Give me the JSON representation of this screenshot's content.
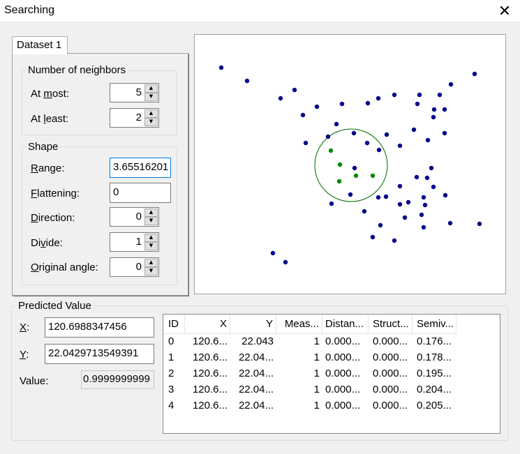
{
  "window": {
    "title": "Searching"
  },
  "tab": {
    "label": "Dataset 1"
  },
  "neighbors": {
    "group_title": "Number of neighbors",
    "at_most_label": "At most:",
    "at_most_value": "5",
    "at_least_label": "At least:",
    "at_least_value": "2"
  },
  "shape": {
    "group_title": "Shape",
    "range_label": "Range:",
    "range_value": "3.65516201",
    "flattening_label": "Flattening:",
    "flattening_value": "0",
    "direction_label": "Direction:",
    "direction_value": "0",
    "divide_label": "Divide:",
    "divide_value": "1",
    "original_angle_label": "Original angle:",
    "original_angle_value": "0"
  },
  "predicted": {
    "group_title": "Predicted Value",
    "x_label": "X:",
    "x_value": "120.6988347456",
    "y_label": "Y:",
    "y_value": "22.0429713549391",
    "value_label": "Value:",
    "value_value": "0.9999999999"
  },
  "table": {
    "columns": [
      "ID",
      "X",
      "Y",
      "Meas...",
      "Distan...",
      "Struct...",
      "Semiv..."
    ],
    "rows": [
      [
        "0",
        "120.6...",
        "22.043",
        "1",
        "0.000...",
        "0.000...",
        "0.176..."
      ],
      [
        "1",
        "120.6...",
        "22.04...",
        "1",
        "0.000...",
        "0.000...",
        "0.178..."
      ],
      [
        "2",
        "120.6...",
        "22.04...",
        "1",
        "0.000...",
        "0.000...",
        "0.195..."
      ],
      [
        "3",
        "120.6...",
        "22.04...",
        "1",
        "0.000...",
        "0.000...",
        "0.204..."
      ],
      [
        "4",
        "120.6...",
        "22.04...",
        "1",
        "0.000...",
        "0.000...",
        "0.205..."
      ]
    ]
  },
  "colors": {
    "point_other": "#00008b",
    "point_selected": "#008b00",
    "search_circle": "#006400"
  }
}
